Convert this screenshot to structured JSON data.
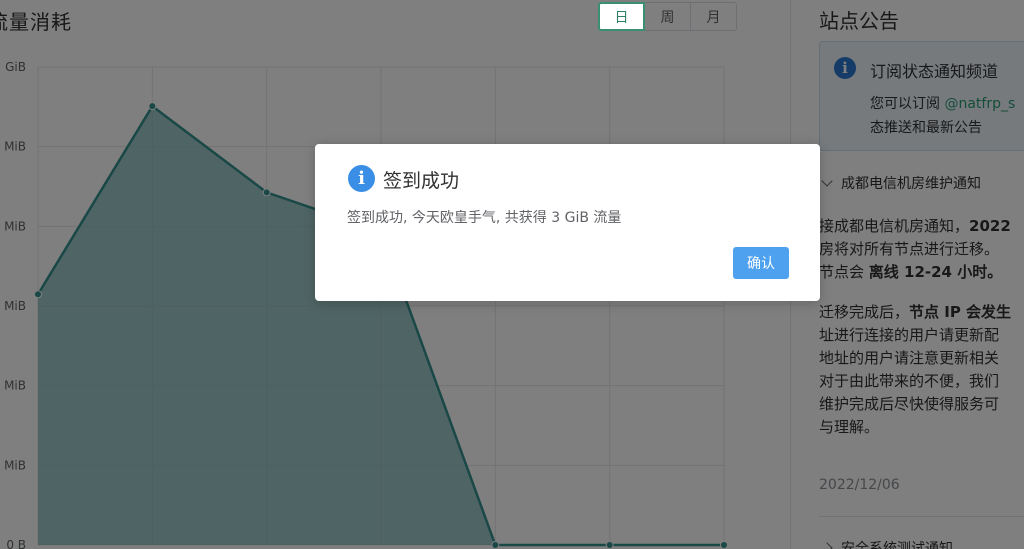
{
  "chart_card": {
    "title": "流量消耗",
    "ranges": [
      {
        "label": "日",
        "active": true
      },
      {
        "label": "周",
        "active": false
      },
      {
        "label": "月",
        "active": false
      }
    ]
  },
  "colors": {
    "chart_line": "#35908e",
    "chart_fill": "#7fb6b5",
    "grid": "#e6e6e6",
    "accent": "#3a8f73",
    "confirm_button": "#4ea1ef",
    "info_icon": "#3a8ee6"
  },
  "chart_data": {
    "type": "area",
    "y_tick_labels": [
      "GiB",
      "MiB",
      "MiB",
      "MiB",
      "MiB",
      "MiB",
      "0 B"
    ],
    "x": [
      0,
      1,
      2,
      3,
      4,
      5,
      6
    ],
    "series": [
      {
        "values": [
          3.2,
          5.6,
          4.5,
          4.0,
          0,
          0,
          0
        ]
      }
    ],
    "ylim": [
      0,
      6.1
    ],
    "grid": true
  },
  "sidebar": {
    "title": "站点公告",
    "notice": {
      "icon": "info-icon",
      "title": "订阅状态通知频道",
      "line1_prefix": "您可以订阅 ",
      "line1_link": "@natfrp_s",
      "line2": "态推送和最新公告"
    },
    "announcement": {
      "header": "成都电信机房维护通知",
      "p1_l1_prefix": "接成都电信机房通知，",
      "p1_l1_bold": "2022",
      "p1_l2": "房将对所有节点进行迁移。",
      "p1_l3_prefix": "节点会 ",
      "p1_l3_bold": "离线 12-24 小时。",
      "p2_l1_prefix": "迁移完成后，",
      "p2_l1_bold": "节点 IP 会发生",
      "p2_l2": "址进行连接的用户请更新配",
      "p2_l3": "地址的用户请注意更新相关",
      "p2_l4": "对于由此带来的不便，我们",
      "p2_l5": "维护完成后尽快使得服务可",
      "p2_l6": "与理解。",
      "date": "2022/12/06"
    },
    "next_header": "安全系统测试通知"
  },
  "dialog": {
    "icon": "info-icon",
    "title": "签到成功",
    "message": "签到成功, 今天欧皇手气, 共获得 3 GiB 流量",
    "confirm_label": "确认"
  }
}
